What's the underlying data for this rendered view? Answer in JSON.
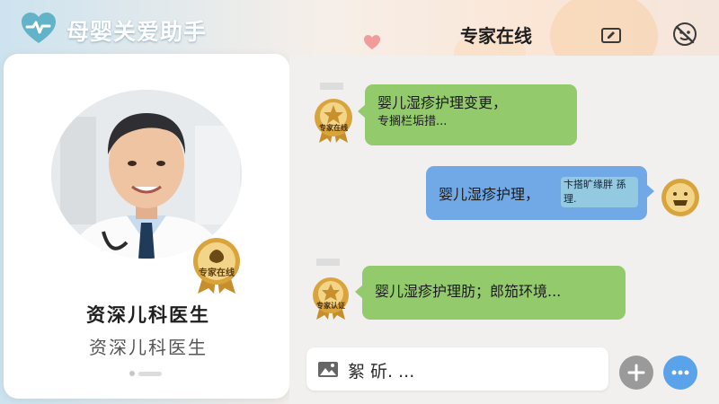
{
  "header": {
    "app_title": "母婴关爱助手",
    "page_title": "专家在线"
  },
  "profile": {
    "badge_label": "专家在线",
    "name": "资深儿科医生",
    "title": "资深儿科医生"
  },
  "chat": {
    "messages": [
      {
        "side": "left",
        "badge_label": "专家在线",
        "line1": "婴儿湿疹护理变更，",
        "line2": "专搁栏垢措..."
      },
      {
        "side": "right",
        "line1": "婴儿湿疹护理，",
        "line2": "卞搭旷缘胖 孫理."
      },
      {
        "side": "left",
        "badge_label": "专家认证",
        "line1": "婴儿湿疹护理肪；郎笳环境..."
      }
    ]
  },
  "input": {
    "value": "絮 斫. ..."
  },
  "icons": {
    "logo": "heart-logo-icon",
    "header_left": "edit-icon",
    "header_right": "mute-icon",
    "avatar_badge": "award-badge-icon",
    "input": "image-icon",
    "plus": "plus-icon",
    "more": "more-icon"
  },
  "colors": {
    "bubble_expert": "#92ca6c",
    "bubble_user": "#70a9e6",
    "badge_gold": "#d9a43c",
    "more_button": "#5aa3ea"
  }
}
